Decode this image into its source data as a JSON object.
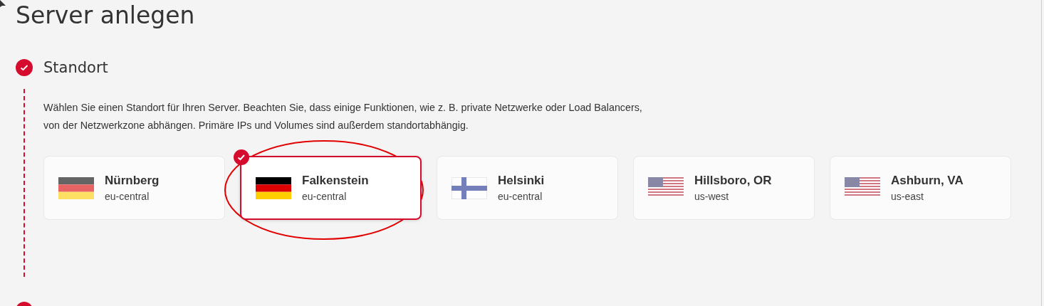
{
  "title": "Server anlegen",
  "steps": [
    {
      "label": "Standort",
      "done": true
    }
  ],
  "description": "Wählen Sie einen Standort für Ihren Server. Beachten Sie, dass einige Funktionen, wie z. B. private Netzwerke oder Load Balancers, von der Netzwerkzone abhängen. Primäre IPs und Volumes sind außerdem standortabhängig.",
  "locations": [
    {
      "name": "Nürnberg",
      "zone": "eu-central",
      "kind": "de",
      "selected": false
    },
    {
      "name": "Falkenstein",
      "zone": "eu-central",
      "kind": "de",
      "selected": true
    },
    {
      "name": "Helsinki",
      "zone": "eu-central",
      "kind": "fi",
      "selected": false
    },
    {
      "name": "Hillsboro, OR",
      "zone": "us-west",
      "kind": "us",
      "selected": false
    },
    {
      "name": "Ashburn, VA",
      "zone": "us-east",
      "kind": "us",
      "selected": false
    }
  ]
}
